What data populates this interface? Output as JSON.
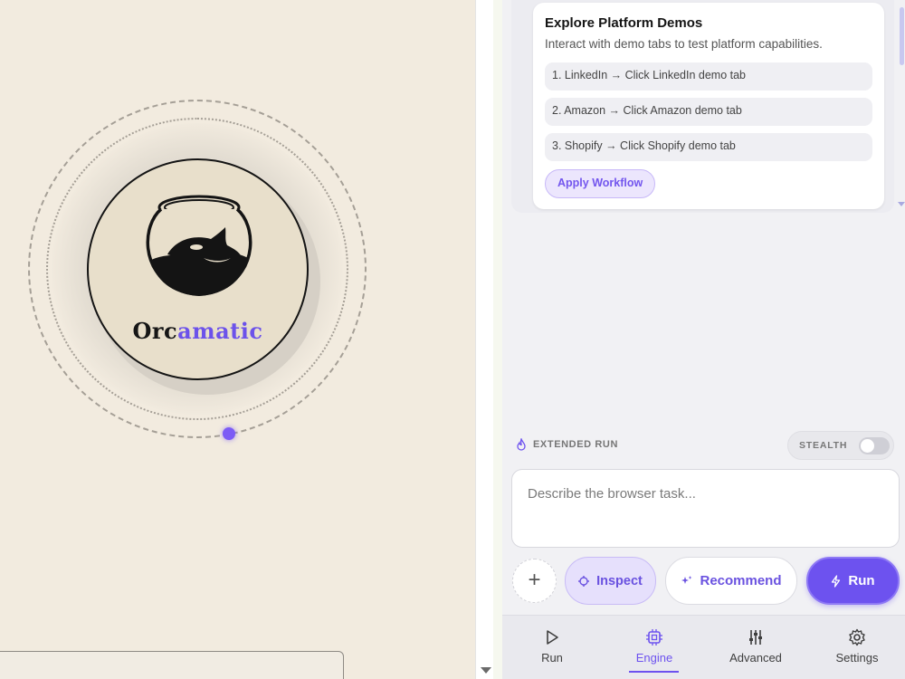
{
  "logo": {
    "text_part1": "Orc",
    "text_part2": "amatic"
  },
  "demo_card": {
    "title": "Explore Platform Demos",
    "subtitle": "Interact with demo tabs to test platform capabilities.",
    "steps": [
      "1. LinkedIn → Click LinkedIn demo tab",
      "2. Amazon → Click Amazon demo tab",
      "3. Shopify → Click Shopify demo tab"
    ],
    "apply_label": "Apply Workflow"
  },
  "extended_run": {
    "label": "EXTENDED RUN",
    "icon": "flame-icon"
  },
  "stealth": {
    "label": "STEALTH",
    "enabled": false
  },
  "task_input": {
    "placeholder": "Describe the browser task...",
    "value": ""
  },
  "actions": {
    "add_icon": "plus-icon",
    "inspect_label": "Inspect",
    "recommend_label": "Recommend",
    "run_label": "Run"
  },
  "nav": {
    "items": [
      {
        "label": "Run",
        "icon": "play-icon"
      },
      {
        "label": "Engine",
        "icon": "chip-icon",
        "active": true
      },
      {
        "label": "Advanced",
        "icon": "sliders-icon"
      },
      {
        "label": "Settings",
        "icon": "gear-icon"
      }
    ]
  },
  "colors": {
    "accent": "#6d52ef",
    "background": "#f2ebdf",
    "panel": "#f1f1f4"
  }
}
